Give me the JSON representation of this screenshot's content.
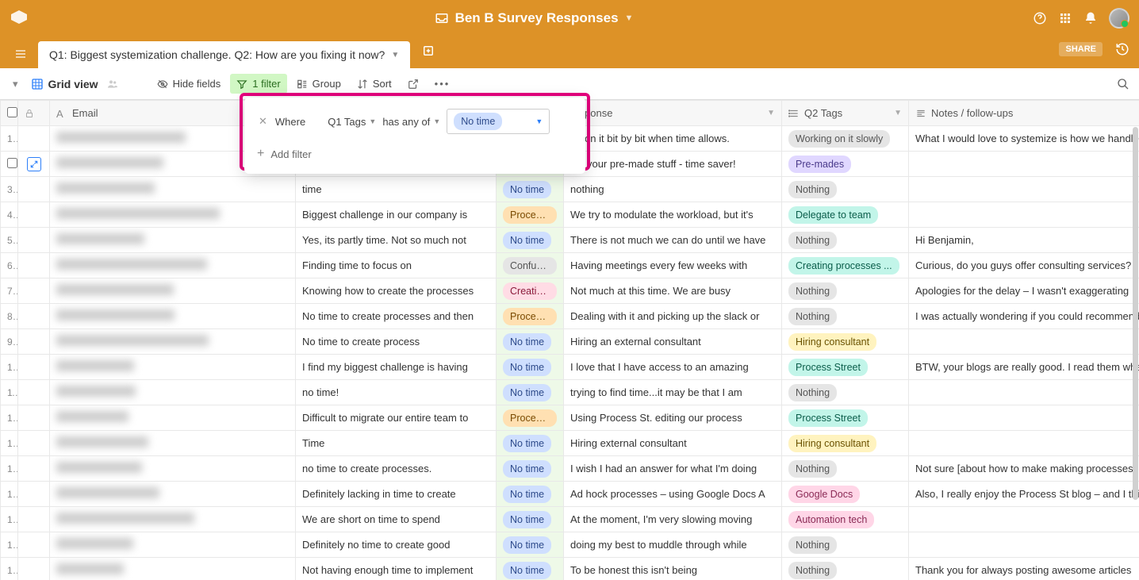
{
  "header": {
    "base_name": "Ben B Survey Responses",
    "share": "SHARE"
  },
  "tab": {
    "label": "Q1: Biggest systemization challenge. Q2: How are you fixing it now?"
  },
  "toolbar": {
    "view_name": "Grid view",
    "hide_fields": "Hide fields",
    "filter": "1 filter",
    "group": "Group",
    "sort": "Sort"
  },
  "filter_popup": {
    "where": "Where",
    "field": "Q1 Tags",
    "operator": "has any of",
    "value": "No time",
    "add_filter": "Add filter"
  },
  "columns": {
    "email": "Email",
    "q1": "",
    "q1tags": "",
    "response": "response",
    "q2tags": "Q2 Tags",
    "notes": "Notes / follow-ups"
  },
  "tag_colors": {
    "No time": "blue",
    "Working on it slowly": "gray",
    "Pre-mades": "purple",
    "Nothing": "gray",
    "Process ...": "orange",
    "Delegate to team": "teal",
    "Confuse...": "gray",
    "Creating processes ...": "teal",
    "Creating...": "red",
    "Hiring consultant": "yellow",
    "Process Street": "teal",
    "Google Docs": "pink",
    "Automation tech": "pink"
  },
  "rows": [
    {
      "n": 1,
      "q1": "",
      "q1tag": "",
      "resp": "ng on it bit by bit when time allows.",
      "q2tag": "Working on it slowly",
      "notes": "What I would love to systemize is how we handle"
    },
    {
      "n": 2,
      "q1": "",
      "q1tag": "",
      "resp": "ing your pre-made stuff - time saver!",
      "q2tag": "Pre-mades",
      "notes": "",
      "expand": true,
      "checkbox": true
    },
    {
      "n": 3,
      "q1": "time",
      "q1tag": "No time",
      "resp": "nothing",
      "q2tag": "Nothing",
      "notes": ""
    },
    {
      "n": 4,
      "q1": "Biggest challenge in our company is",
      "q1tag": "Process ...",
      "resp": "We try to modulate the workload, but it's",
      "q2tag": "Delegate to team",
      "notes": ""
    },
    {
      "n": 5,
      "q1": "Yes, its partly time. Not so much not",
      "q1tag": "No time",
      "resp": "There is not much we can do until we have",
      "q2tag": "Nothing",
      "notes": "Hi Benjamin,"
    },
    {
      "n": 6,
      "q1": "Finding time to focus on",
      "q1tag": "Confuse...",
      "resp": "Having meetings every few weeks with",
      "q2tag": "Creating processes ...",
      "notes": "Curious, do you guys offer consulting services?"
    },
    {
      "n": 7,
      "q1": "Knowing how to create the processes",
      "q1tag": "Creating...",
      "resp": "Not much at this time. We are busy",
      "q2tag": "Nothing",
      "notes": "Apologies for the delay – I wasn't exaggerating"
    },
    {
      "n": 8,
      "q1": "No time to create processes and then",
      "q1tag": "Process ...",
      "resp": "Dealing with it and picking up the slack or",
      "q2tag": "Nothing",
      "notes": "I was actually wondering if you could recommend"
    },
    {
      "n": 9,
      "q1": "No time to create process",
      "q1tag": "No time",
      "resp": "Hiring an external consultant",
      "q2tag": "Hiring consultant",
      "notes": ""
    },
    {
      "n": 10,
      "q1": "I find my biggest challenge is having",
      "q1tag": "No time",
      "resp": "I love that I have access to an amazing",
      "q2tag": "Process Street",
      "notes": "BTW, your blogs are really good. I read them when"
    },
    {
      "n": 11,
      "q1": "no time!",
      "q1tag": "No time",
      "resp": "trying to find time...it may be that I am",
      "q2tag": "Nothing",
      "notes": ""
    },
    {
      "n": 12,
      "q1": "Difficult to migrate our entire team to",
      "q1tag": "Process ...",
      "resp": "Using Process St. editing our process",
      "q2tag": "Process Street",
      "notes": ""
    },
    {
      "n": 13,
      "q1": "Time",
      "q1tag": "No time",
      "resp": "Hiring external consultant",
      "q2tag": "Hiring consultant",
      "notes": ""
    },
    {
      "n": 14,
      "q1": "no time to create processes.",
      "q1tag": "No time",
      "resp": "I wish I had an answer for what I'm doing",
      "q2tag": "Nothing",
      "notes": "Not sure [about how to make making processes"
    },
    {
      "n": 15,
      "q1": "Definitely lacking in time to create",
      "q1tag": "No time",
      "resp": "Ad hock processes – using Google Docs A",
      "q2tag": "Google Docs",
      "notes": "Also, I really enjoy the Process St blog – and I think"
    },
    {
      "n": 16,
      "q1": "We are short on time to spend",
      "q1tag": "No time",
      "resp": "At the moment, I'm very slowing moving",
      "q2tag": "Automation tech",
      "notes": ""
    },
    {
      "n": 17,
      "q1": "Definitely no time to create good",
      "q1tag": "No time",
      "resp": "doing my best to muddle through while",
      "q2tag": "Nothing",
      "notes": ""
    },
    {
      "n": 18,
      "q1": "Not having enough time to implement",
      "q1tag": "No time",
      "resp": "To be honest this isn't being",
      "q2tag": "Nothing",
      "notes": "Thank you for always posting awesome articles"
    }
  ]
}
